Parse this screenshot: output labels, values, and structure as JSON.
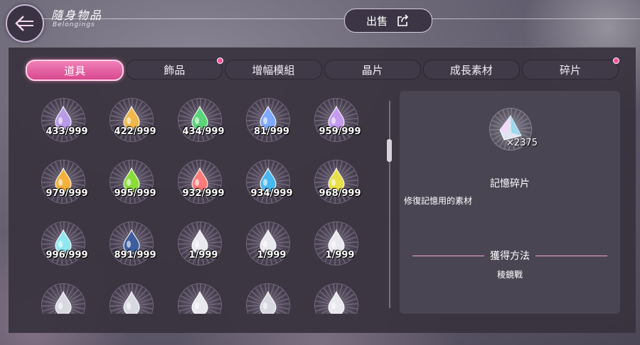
{
  "header": {
    "title_zh": "隨身物品",
    "title_en": "Belongings",
    "back_icon": "arrow-left-icon",
    "sell_label": "出售",
    "sell_icon": "export-icon"
  },
  "tabs": [
    {
      "label": "道具",
      "active": true,
      "dot": false
    },
    {
      "label": "飾品",
      "active": false,
      "dot": true
    },
    {
      "label": "增幅模組",
      "active": false,
      "dot": false
    },
    {
      "label": "晶片",
      "active": false,
      "dot": false
    },
    {
      "label": "成長素材",
      "active": false,
      "dot": false
    },
    {
      "label": "碎片",
      "active": false,
      "dot": true
    }
  ],
  "items": [
    {
      "count": "433/999",
      "color": "#b89ae8"
    },
    {
      "count": "422/999",
      "color": "#f0b84a"
    },
    {
      "count": "434/999",
      "color": "#5cd47a"
    },
    {
      "count": "81/999",
      "color": "#7fa8ff"
    },
    {
      "count": "959/999",
      "color": "#c49af0"
    },
    {
      "count": "979/999",
      "color": "#f7b13a"
    },
    {
      "count": "995/999",
      "color": "#8bdc3a"
    },
    {
      "count": "932/999",
      "color": "#ff7a7a"
    },
    {
      "count": "934/999",
      "color": "#4ab8f0"
    },
    {
      "count": "968/999",
      "color": "#e8e048"
    },
    {
      "count": "996/999",
      "color": "#8fe8f0"
    },
    {
      "count": "891/999",
      "color": "#3d5e9e"
    },
    {
      "count": "1/999",
      "color": "#e8e8ee"
    },
    {
      "count": "1/999",
      "color": "#e8e8ee"
    },
    {
      "count": "1/999",
      "color": "#e8e8ee"
    },
    {
      "count": "",
      "color": "#d8d8e0"
    },
    {
      "count": "",
      "color": "#d8d8e0"
    },
    {
      "count": "",
      "color": "#e8e8ee"
    },
    {
      "count": "",
      "color": "#d8d8e0"
    },
    {
      "count": "",
      "color": "#e8e8ee"
    }
  ],
  "detail": {
    "count": "×2375",
    "name": "記憶碎片",
    "description": "修復記憶用的素材",
    "obtain_label": "獲得方法",
    "source": "稜鏡戰",
    "icon": "crystal-shard-icon"
  }
}
